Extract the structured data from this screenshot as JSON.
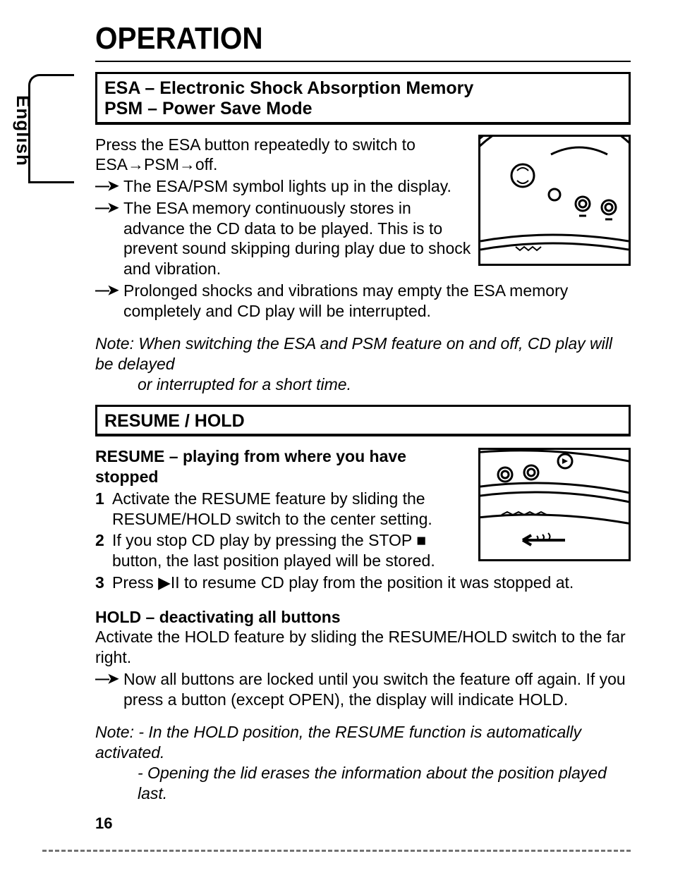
{
  "title": "OPERATION",
  "language_tab": "English",
  "page_number": "16",
  "section1": {
    "heading_line1": "ESA  – Electronic Shock Absorption Memory",
    "heading_line2": "PSM – Power Save Mode",
    "intro": "Press the ESA button repeatedly to switch to ESA→PSM→off.",
    "bullets": [
      "The ESA/PSM symbol lights up in the display.",
      "The ESA memory continuously stores in advance the CD data to be played. This is to prevent sound skipping during play due to shock and vibration.",
      "Prolonged shocks and vibrations may empty the ESA memory completely and CD play will be interrupted."
    ],
    "note_lead": "Note: When switching the ESA and PSM feature on and off, CD play will be delayed",
    "note_cont": "or interrupted for a short time."
  },
  "section2": {
    "heading": "RESUME / HOLD",
    "sub1_head": "RESUME – playing from where you have stopped",
    "steps": [
      "Activate the RESUME feature by sliding the RESUME/HOLD switch to the center setting.",
      "If you stop CD play by pressing the STOP ■ button, the last position played will be stored.",
      "Press ▶II to resume CD play from the position it was stopped at."
    ],
    "sub2_head": "HOLD – deactivating all buttons",
    "sub2_intro": "Activate the HOLD feature by sliding the RESUME/HOLD switch to the far right.",
    "sub2_bullet": "Now all buttons are locked until you switch the feature off again. If you press a button (except OPEN), the display will indicate HOLD.",
    "note2_lead": "Note: - In the HOLD position, the RESUME function is automatically activated.",
    "note2_cont": "- Opening the lid erases the information about the position played last."
  }
}
